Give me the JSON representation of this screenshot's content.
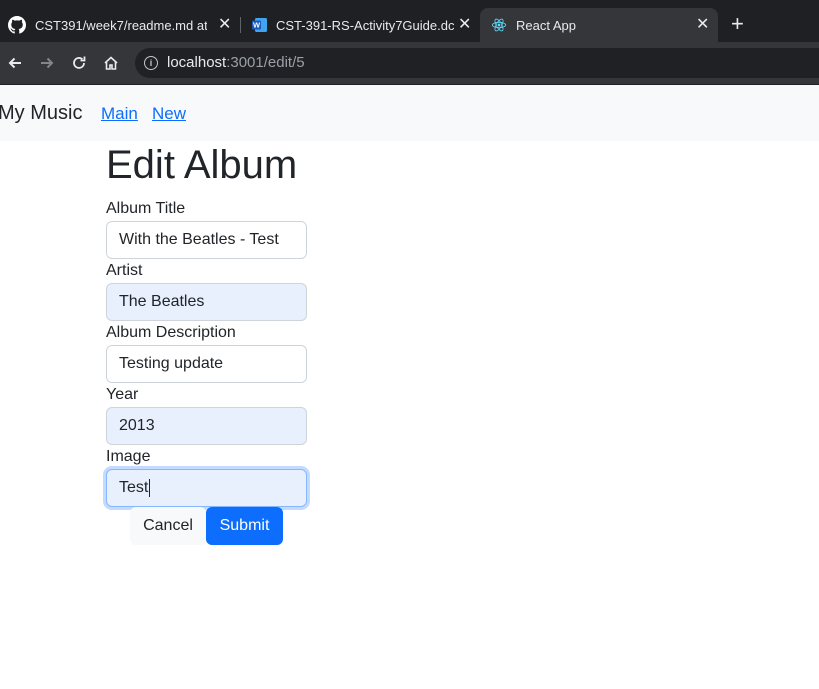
{
  "browser": {
    "tabs": [
      {
        "title": "CST391/week7/readme.md at m",
        "icon": "github-icon"
      },
      {
        "title": "CST-391-RS-Activity7Guide.dc",
        "icon": "word-icon"
      },
      {
        "title": "React App",
        "icon": "react-icon"
      }
    ],
    "url_host": "localhost",
    "url_path": ":3001/edit/5"
  },
  "navbar": {
    "brand": "My Music",
    "links": [
      "Main",
      "New"
    ]
  },
  "form": {
    "heading": "Edit Album",
    "fields": [
      {
        "label": "Album Title",
        "value": "With the Beatles - Test"
      },
      {
        "label": "Artist",
        "value": "The Beatles"
      },
      {
        "label": "Album Description",
        "value": "Testing update"
      },
      {
        "label": "Year",
        "value": "2013"
      },
      {
        "label": "Image",
        "value": "Test"
      }
    ],
    "cancel_label": "Cancel",
    "submit_label": "Submit"
  },
  "colors": {
    "primary": "#0d6efd",
    "autofill_bg": "#e8f0fe",
    "tabbar": "#1f2023"
  }
}
